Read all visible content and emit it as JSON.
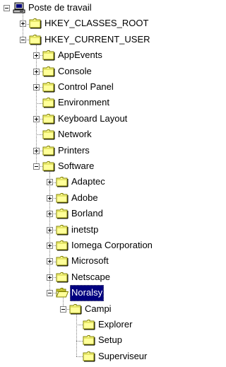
{
  "colors": {
    "folder_fill": "#ffff99",
    "folder_shade": "#cccc33",
    "folder_outline": "#808000",
    "tree_line": "#808080",
    "selection": "#000080"
  },
  "tree": {
    "root": {
      "label": "Poste de travail",
      "icon": "computer-icon"
    },
    "nodes": [
      {
        "id": "hkcr",
        "label": "HKEY_CLASSES_ROOT",
        "depth": 1,
        "expander": "plus",
        "icon": "folder-closed-icon"
      },
      {
        "id": "hkcu",
        "label": "HKEY_CURRENT_USER",
        "depth": 1,
        "expander": "minus",
        "icon": "folder-closed-icon"
      },
      {
        "id": "appevents",
        "label": "AppEvents",
        "depth": 2,
        "expander": "plus",
        "icon": "folder-closed-icon"
      },
      {
        "id": "console",
        "label": "Console",
        "depth": 2,
        "expander": "plus",
        "icon": "folder-closed-icon"
      },
      {
        "id": "control-panel",
        "label": "Control Panel",
        "depth": 2,
        "expander": "plus",
        "icon": "folder-closed-icon"
      },
      {
        "id": "environment",
        "label": "Environment",
        "depth": 2,
        "expander": "none",
        "icon": "folder-closed-icon"
      },
      {
        "id": "keyboard-layout",
        "label": "Keyboard Layout",
        "depth": 2,
        "expander": "plus",
        "icon": "folder-closed-icon"
      },
      {
        "id": "network",
        "label": "Network",
        "depth": 2,
        "expander": "none",
        "icon": "folder-closed-icon"
      },
      {
        "id": "printers",
        "label": "Printers",
        "depth": 2,
        "expander": "plus",
        "icon": "folder-closed-icon"
      },
      {
        "id": "software",
        "label": "Software",
        "depth": 2,
        "expander": "minus",
        "icon": "folder-closed-icon"
      },
      {
        "id": "adaptec",
        "label": "Adaptec",
        "depth": 3,
        "expander": "plus",
        "icon": "folder-closed-icon"
      },
      {
        "id": "adobe",
        "label": "Adobe",
        "depth": 3,
        "expander": "plus",
        "icon": "folder-closed-icon"
      },
      {
        "id": "borland",
        "label": "Borland",
        "depth": 3,
        "expander": "plus",
        "icon": "folder-closed-icon"
      },
      {
        "id": "inetstp",
        "label": "inetstp",
        "depth": 3,
        "expander": "plus",
        "icon": "folder-closed-icon"
      },
      {
        "id": "iomega",
        "label": "Iomega Corporation",
        "depth": 3,
        "expander": "plus",
        "icon": "folder-closed-icon"
      },
      {
        "id": "microsoft",
        "label": "Microsoft",
        "depth": 3,
        "expander": "plus",
        "icon": "folder-closed-icon"
      },
      {
        "id": "netscape",
        "label": "Netscape",
        "depth": 3,
        "expander": "plus",
        "icon": "folder-closed-icon"
      },
      {
        "id": "noralsy",
        "label": "Noralsy",
        "depth": 3,
        "expander": "minus",
        "icon": "folder-open-icon",
        "selected": true
      },
      {
        "id": "campi",
        "label": "Campi",
        "depth": 4,
        "expander": "minus",
        "icon": "folder-closed-icon"
      },
      {
        "id": "explorer",
        "label": "Explorer",
        "depth": 5,
        "expander": "none",
        "icon": "folder-closed-icon"
      },
      {
        "id": "setup",
        "label": "Setup",
        "depth": 5,
        "expander": "none",
        "icon": "folder-closed-icon"
      },
      {
        "id": "superviseur",
        "label": "Superviseur",
        "depth": 5,
        "expander": "none",
        "icon": "folder-closed-icon"
      }
    ]
  }
}
